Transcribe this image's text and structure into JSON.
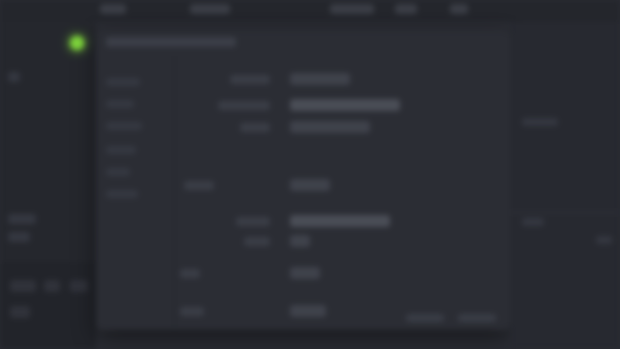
{
  "app": {
    "title": "",
    "accent": "#7bd13a",
    "background": "#2a2c33"
  },
  "topbar": {
    "items": [
      "",
      "",
      "",
      "",
      ""
    ]
  },
  "left_pane": {
    "items": [
      "",
      "",
      "",
      "",
      "",
      "",
      ""
    ]
  },
  "dialog": {
    "title": "",
    "side_items": [
      "",
      "",
      "",
      "",
      "",
      ""
    ],
    "rows": [
      {
        "label": "",
        "value": ""
      },
      {
        "label": "",
        "value": ""
      },
      {
        "label": "",
        "value": ""
      },
      {
        "label": "",
        "value": ""
      },
      {
        "label": "",
        "value": ""
      },
      {
        "label": "",
        "value": ""
      },
      {
        "label": "",
        "value": ""
      },
      {
        "label": "",
        "value": ""
      }
    ],
    "footer_buttons": [
      "",
      ""
    ]
  },
  "right_pane": {
    "items": [
      "",
      "",
      ""
    ]
  }
}
